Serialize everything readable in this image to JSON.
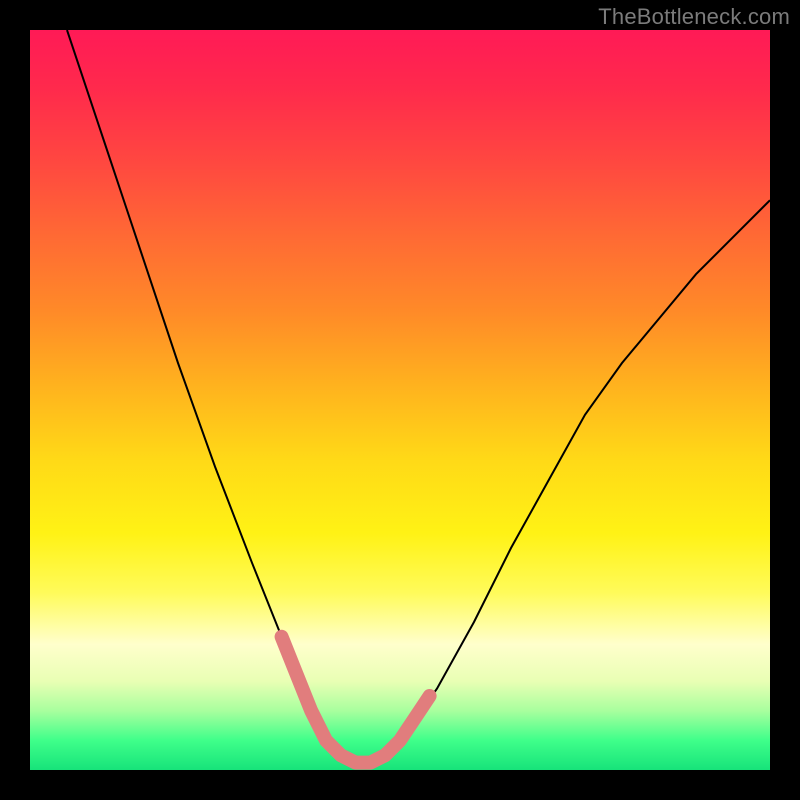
{
  "watermark": "TheBottleneck.com",
  "chart_data": {
    "type": "line",
    "title": "",
    "xlabel": "",
    "ylabel": "",
    "xlim": [
      0,
      100
    ],
    "ylim": [
      0,
      100
    ],
    "grid": false,
    "series": [
      {
        "name": "bottleneck-curve",
        "x": [
          5,
          10,
          15,
          20,
          25,
          30,
          34,
          36,
          38,
          40,
          42,
          44,
          46,
          48,
          50,
          55,
          60,
          65,
          70,
          75,
          80,
          85,
          90,
          95,
          100
        ],
        "y": [
          100,
          85,
          70,
          55,
          41,
          28,
          18,
          13,
          8,
          4,
          2,
          1,
          1,
          2,
          4,
          11,
          20,
          30,
          39,
          48,
          55,
          61,
          67,
          72,
          77
        ]
      }
    ],
    "highlight": {
      "name": "valley-markers",
      "points": [
        {
          "x": 34,
          "y": 18
        },
        {
          "x": 36,
          "y": 13
        },
        {
          "x": 38,
          "y": 8
        },
        {
          "x": 40,
          "y": 4
        },
        {
          "x": 42,
          "y": 2
        },
        {
          "x": 44,
          "y": 1
        },
        {
          "x": 46,
          "y": 1
        },
        {
          "x": 48,
          "y": 2
        },
        {
          "x": 50,
          "y": 4
        },
        {
          "x": 52,
          "y": 7
        },
        {
          "x": 54,
          "y": 10
        }
      ]
    },
    "background_gradient": {
      "top": "#ff1a56",
      "mid": "#fff215",
      "bottom": "#17e37a"
    }
  }
}
